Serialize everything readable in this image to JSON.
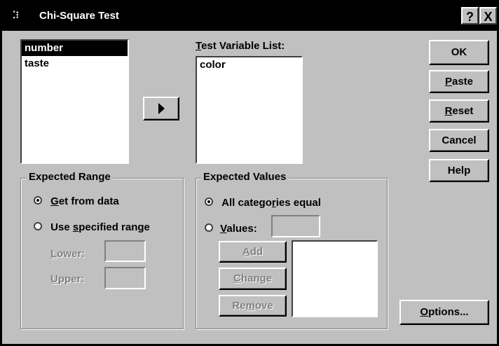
{
  "window": {
    "title": "Chi-Square Test",
    "help_btn": "?",
    "close_btn": "X"
  },
  "source_list": {
    "items": [
      "number",
      "taste"
    ],
    "selected": "number"
  },
  "move_button": {
    "icon": "arrow-right-icon"
  },
  "test_variable": {
    "label": "Test Variable List:",
    "items": [
      "color"
    ]
  },
  "buttons": {
    "ok": "OK",
    "paste": "Paste",
    "reset": "Reset",
    "cancel": "Cancel",
    "help": "Help",
    "options": "Options..."
  },
  "expected_range": {
    "legend": "Expected Range",
    "get_from_data": "Get from data",
    "use_specified": "Use specified range",
    "selected": "get_from_data",
    "lower_label": "Lower:",
    "upper_label": "Upper:",
    "lower_value": "",
    "upper_value": ""
  },
  "expected_values": {
    "legend": "Expected Values",
    "all_equal": "All categories equal",
    "values_label": "Values:",
    "selected": "all_equal",
    "values_input": "",
    "add": "Add",
    "change": "Change",
    "remove": "Remove",
    "values_list": []
  }
}
